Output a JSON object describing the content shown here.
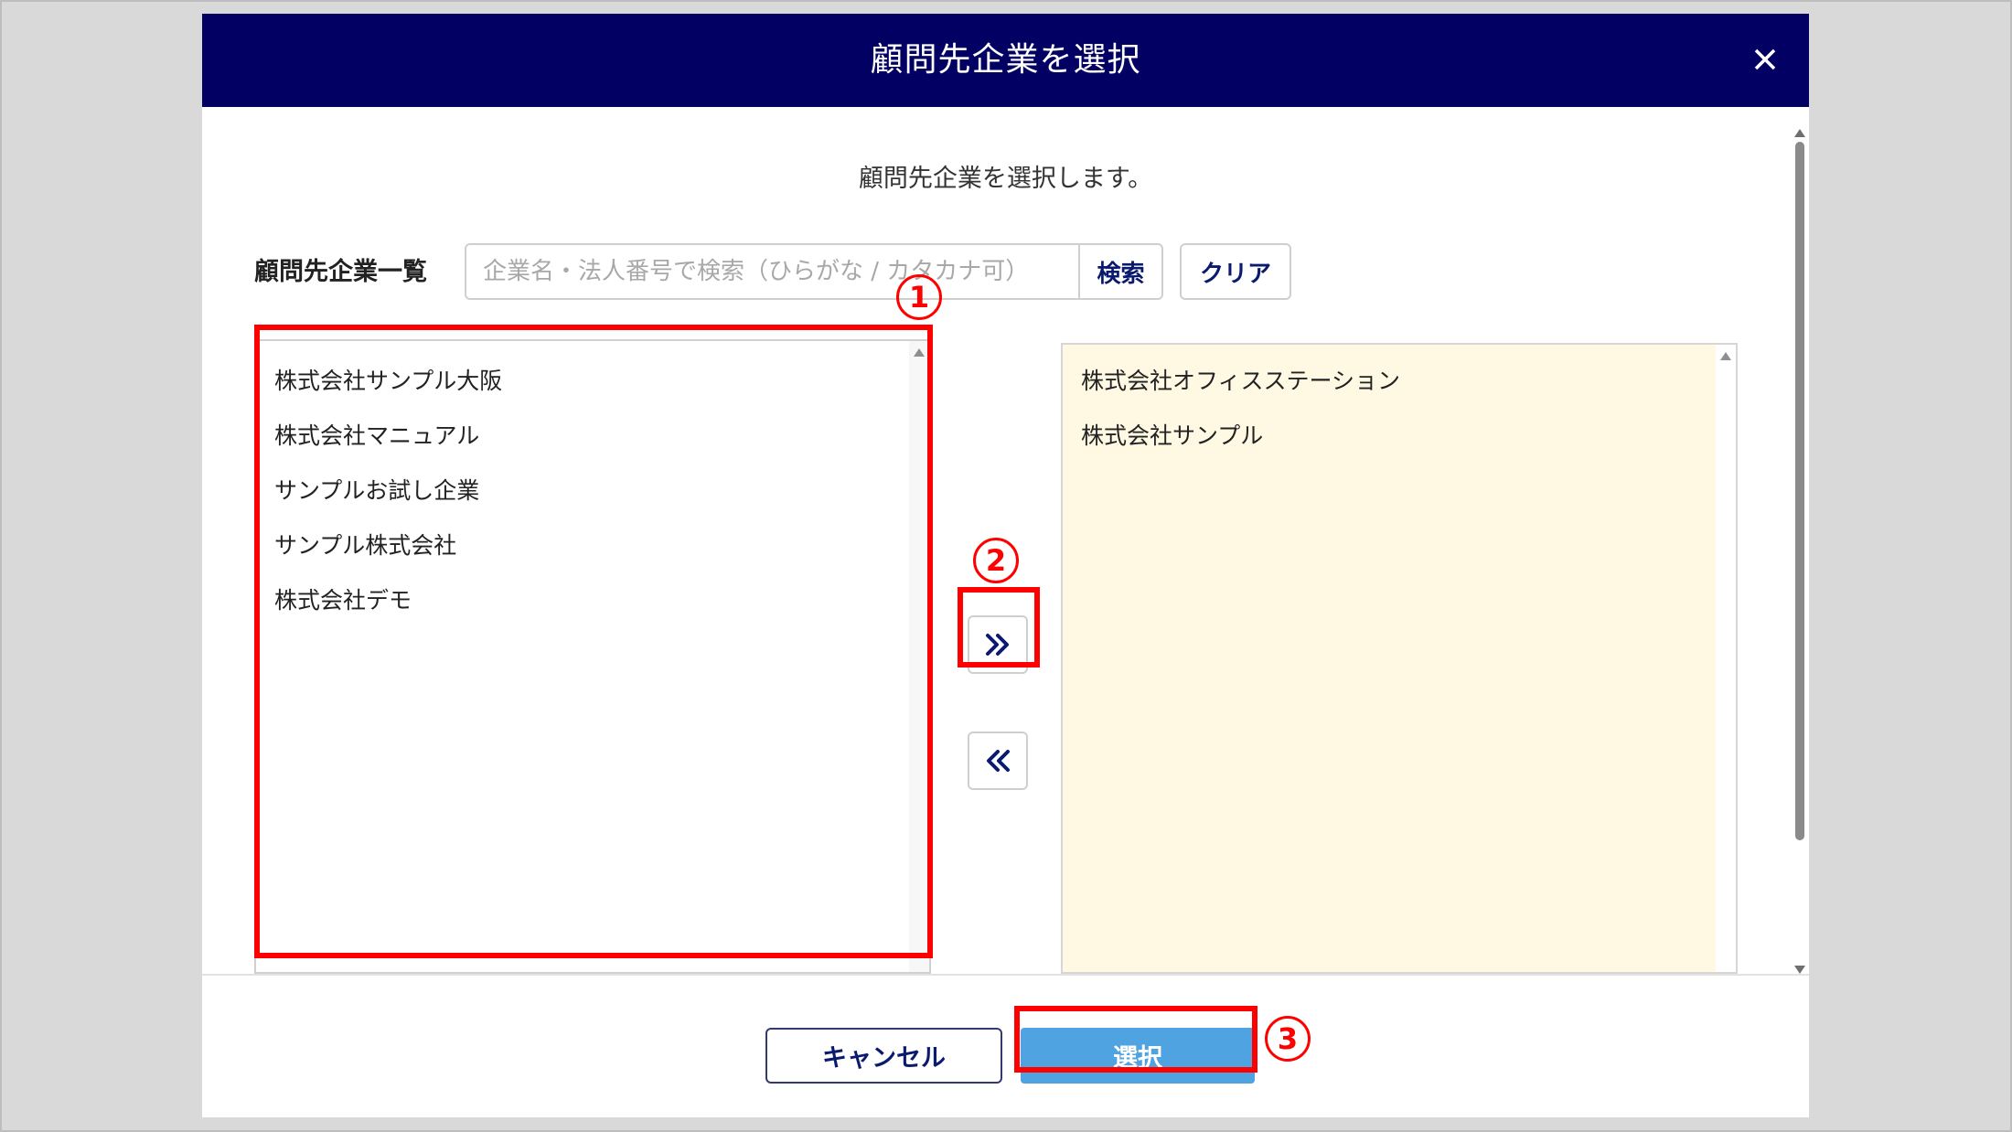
{
  "modal": {
    "title": "顧問先企業を選択",
    "description": "顧問先企業を選択します。"
  },
  "search": {
    "label": "顧問先企業一覧",
    "placeholder": "企業名・法人番号で検索（ひらがな / カタカナ可）",
    "search_label": "検索",
    "clear_label": "クリア"
  },
  "available_list": {
    "items": [
      "株式会社サンプル大阪",
      "株式会社マニュアル",
      "サンプルお試し企業",
      "サンプル株式会社",
      "株式会社デモ"
    ]
  },
  "selected_list": {
    "items": [
      "株式会社オフィスステーション",
      "株式会社サンプル"
    ]
  },
  "footer": {
    "cancel_label": "キャンセル",
    "select_label": "選択"
  },
  "annotations": {
    "step1": "1",
    "step2": "2",
    "step3": "3"
  },
  "colors": {
    "header_bg": "#020062",
    "selected_list_bg": "#fff8e3",
    "primary_button": "#4fa3e0",
    "annotation": "#ff0000"
  }
}
